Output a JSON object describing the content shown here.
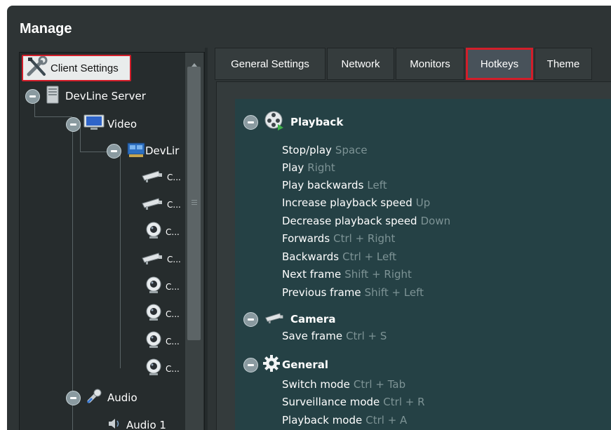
{
  "window": {
    "title": "Manage"
  },
  "tree": {
    "client_settings": "Client Settings",
    "server": "DevLine Server",
    "video": "Video",
    "device": "DevLir",
    "cameras": [
      "C...",
      "C...",
      "C...",
      "C...",
      "C...",
      "C...",
      "C...",
      "C..."
    ],
    "audio": "Audio",
    "audio_item": "Audio 1"
  },
  "tabs": [
    "General Settings",
    "Network",
    "Monitors",
    "Hotkeys",
    "Theme"
  ],
  "active_tab": "Hotkeys",
  "sections": [
    {
      "title": "Playback",
      "icon": "film-reel-icon",
      "items": [
        {
          "action": "Stop/play",
          "key": "Space"
        },
        {
          "action": "Play",
          "key": "Right"
        },
        {
          "action": "Play backwards",
          "key": "Left"
        },
        {
          "action": "Increase playback speed",
          "key": "Up"
        },
        {
          "action": "Decrease playback speed",
          "key": "Down"
        },
        {
          "action": "Forwards",
          "key": "Ctrl + Right"
        },
        {
          "action": "Backwards",
          "key": "Ctrl + Left"
        },
        {
          "action": "Next frame",
          "key": "Shift + Right"
        },
        {
          "action": "Previous frame",
          "key": "Shift + Left"
        }
      ]
    },
    {
      "title": "Camera",
      "icon": "camera-icon",
      "items": [
        {
          "action": "Save frame",
          "key": "Ctrl + S"
        }
      ]
    },
    {
      "title": "General",
      "icon": "gear-icon",
      "items": [
        {
          "action": "Switch mode",
          "key": "Ctrl + Tab"
        },
        {
          "action": "Surveillance mode",
          "key": "Ctrl + R"
        },
        {
          "action": "Playback mode",
          "key": "Ctrl + A"
        }
      ]
    }
  ],
  "colors": {
    "highlight": "#d21e2a",
    "key_text": "#7d9395",
    "panel": "#254145"
  }
}
